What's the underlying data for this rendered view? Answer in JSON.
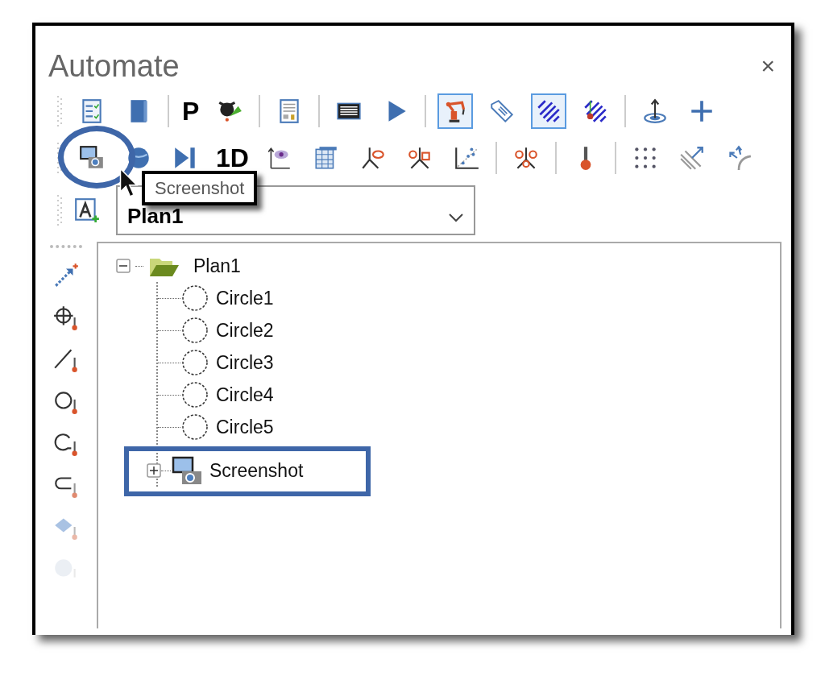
{
  "panel": {
    "title": "Automate",
    "close": "×"
  },
  "toolbar_rows": [
    {
      "items": [
        {
          "kind": "icon",
          "selected": false
        },
        {
          "kind": "icon",
          "selected": false
        },
        {
          "kind": "separator"
        },
        {
          "kind": "text",
          "text": "P"
        },
        {
          "kind": "icon",
          "selected": false
        },
        {
          "kind": "separator"
        },
        {
          "kind": "icon",
          "selected": false
        },
        {
          "kind": "separator"
        },
        {
          "kind": "icon",
          "selected": false
        },
        {
          "kind": "icon",
          "selected": false
        },
        {
          "kind": "separator"
        },
        {
          "kind": "icon",
          "selected": true
        },
        {
          "kind": "icon",
          "selected": false
        },
        {
          "kind": "icon",
          "selected": true
        },
        {
          "kind": "icon",
          "selected": false
        },
        {
          "kind": "separator"
        },
        {
          "kind": "icon",
          "selected": false
        },
        {
          "kind": "icon",
          "selected": false
        }
      ]
    },
    {
      "items": [
        {
          "kind": "icon",
          "selected": false
        },
        {
          "kind": "icon",
          "selected": false
        },
        {
          "kind": "icon",
          "selected": false
        },
        {
          "kind": "text",
          "text": "1D"
        },
        {
          "kind": "icon",
          "selected": false
        },
        {
          "kind": "icon",
          "selected": false
        },
        {
          "kind": "icon",
          "selected": false
        },
        {
          "kind": "icon",
          "selected": false
        },
        {
          "kind": "icon",
          "selected": false
        },
        {
          "kind": "separator"
        },
        {
          "kind": "icon",
          "selected": false
        },
        {
          "kind": "separator"
        },
        {
          "kind": "icon",
          "selected": false
        },
        {
          "kind": "separator"
        },
        {
          "kind": "icon",
          "selected": false
        },
        {
          "kind": "icon",
          "selected": false
        },
        {
          "kind": "icon",
          "selected": false
        }
      ]
    }
  ],
  "tooltip": {
    "text": "Screenshot"
  },
  "plan_combo": {
    "value": "Plan1"
  },
  "tree": [
    {
      "label": "Plan1",
      "expanded": true,
      "children": [
        {
          "label": "Circle1"
        },
        {
          "label": "Circle2"
        },
        {
          "label": "Circle3"
        },
        {
          "label": "Circle4"
        },
        {
          "label": "Circle5"
        },
        {
          "label": "Screenshot",
          "expanded": false,
          "highlighted": true
        }
      ]
    }
  ]
}
